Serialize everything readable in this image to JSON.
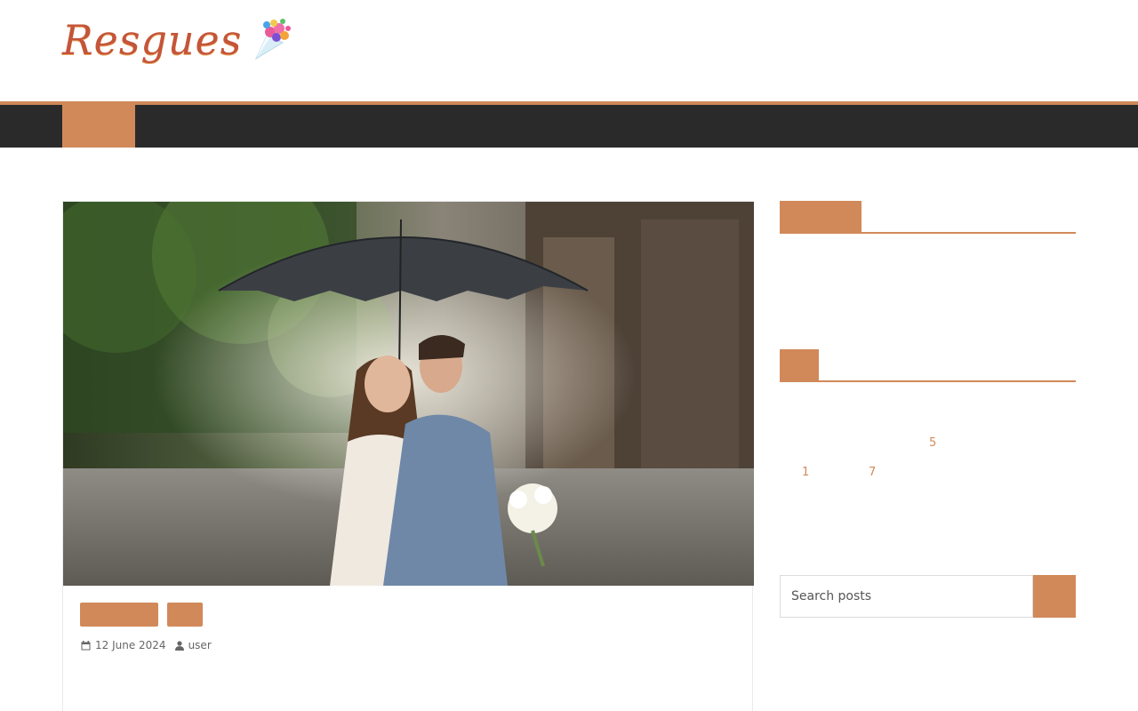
{
  "site": {
    "logo_text": "Resgues"
  },
  "post": {
    "date": "12 June 2024",
    "author": "user"
  },
  "sidebar": {
    "calendar_links": [
      "5",
      "1",
      "7"
    ],
    "search": {
      "placeholder": "Search posts"
    }
  },
  "colors": {
    "accent": "#d1895a",
    "nav_bg": "#2a2a2a"
  },
  "icons": [
    "calendar-icon",
    "user-icon",
    "flower-bouquet-icon"
  ]
}
